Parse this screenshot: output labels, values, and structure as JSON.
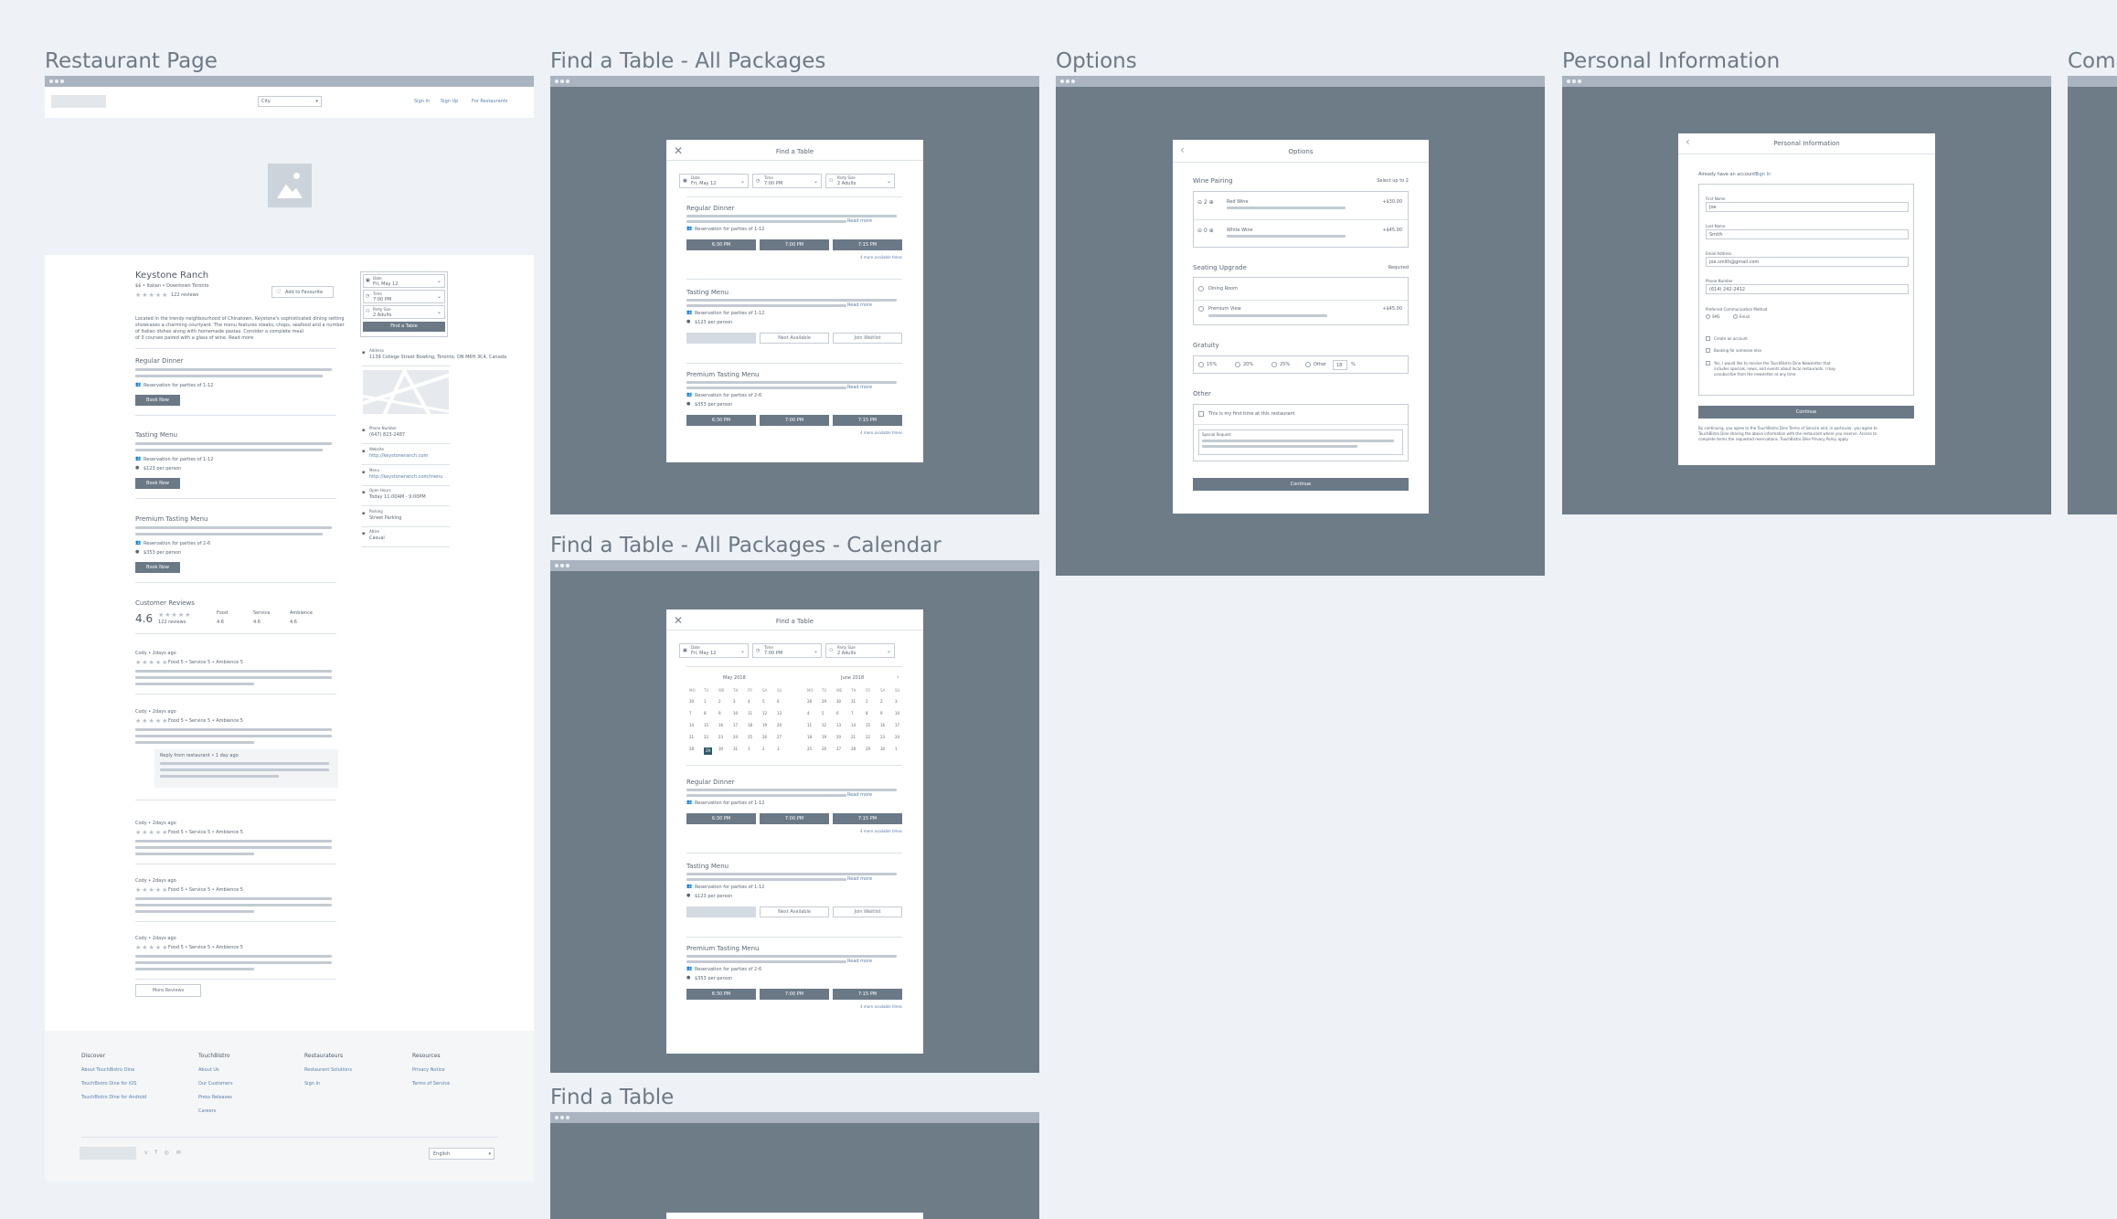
{
  "frames": {
    "restaurant": "Restaurant Page",
    "find_all": "Find a Table - All Packages",
    "options": "Options",
    "personal": "Personal Information",
    "comp": "Comp",
    "find_cal": "Find a Table - All Packages - Calendar",
    "find_table": "Find a Table"
  },
  "rp": {
    "city": "City",
    "signin": "Sign In",
    "signup": "Sign Up",
    "for_rest": "For Restaurants",
    "name": "Keystone Ranch",
    "meta": "$$ • Italian • Downtown Toronto",
    "reviews_count": "122 reviews",
    "fav": "Add to Favourite",
    "desc1": "Located in the trendy neighbourhood of Chinatown, Keystone's sophisticated dining setting",
    "desc2": "showcases a charming courtyard. The menu features steaks, chops, seafood and a number",
    "desc3": "of Italian dishes along with homemade pastas. Consider a complete meal",
    "desc4": "of 3 courses paired with a glass of wine. Read more",
    "pkgs": [
      {
        "name": "Regular Dinner",
        "res": "Reservation for parties of 1-12",
        "price": "",
        "book": "Book Now"
      },
      {
        "name": "Tasting Menu",
        "res": "Reservation for parties of 1-12",
        "price": "$123 per person",
        "book": "Book Now"
      },
      {
        "name": "Premium Tasting Menu",
        "res": "Reservation for parties of 2-6",
        "price": "$353 per person",
        "book": "Book Now"
      }
    ],
    "widget": {
      "date_l": "Date",
      "date": "Fri, May 12",
      "time_l": "Time",
      "time": "7:00 PM",
      "party_l": "Party Size",
      "party": "2 Adults",
      "btn": "Find a Table"
    },
    "side": [
      {
        "l": "Address",
        "v": "1139 College Street Bowling, Toronto, ON M6H 3C4, Canada"
      },
      {
        "l": "Phone Number",
        "v": "(647) 823-2487"
      },
      {
        "l": "Website",
        "v": "http://keystoneranch.com"
      },
      {
        "l": "Menu",
        "v": "http://keystoneranch.com/menu"
      },
      {
        "l": "Open Hours",
        "v": "Today 11:00AM - 9:00PM"
      },
      {
        "l": "Parking",
        "v": "Street Parking"
      },
      {
        "l": "Attire",
        "v": "Casual"
      }
    ],
    "cr": "Customer Reviews",
    "score": "4.6",
    "cr_count": "122 reviews",
    "sub": [
      {
        "l": "Food",
        "v": "4.6"
      },
      {
        "l": "Service",
        "v": "4.6"
      },
      {
        "l": "Ambience",
        "v": "4.6"
      }
    ],
    "review_head": "Cody • 2days ago",
    "review_sub": "Food 5 • Service 5 • Ambience 5",
    "reply": "Reply from restaurant • 1 day ago",
    "more": "More Reviews",
    "footer": [
      {
        "h": "Discover",
        "items": [
          "About TouchBistro Dine",
          "TouchBistro Dine for iOS",
          "TouchBistro Dine for Android"
        ]
      },
      {
        "h": "TouchBistro",
        "items": [
          "About Us",
          "Our Customers",
          "Press Releases",
          "Careers"
        ]
      },
      {
        "h": "Restaurateurs",
        "items": [
          "Restaurant Solutions",
          "Sign In"
        ]
      },
      {
        "h": "Resources",
        "items": [
          "Privacy Notice",
          "Terms of Service"
        ]
      }
    ],
    "lang": "English"
  },
  "fat": {
    "title": "Find a Table",
    "date_l": "Date",
    "date": "Fri, May 12",
    "time_l": "Time",
    "time": "7:00 PM",
    "party_l": "Party Size",
    "party": "2 Adults",
    "pkgs": [
      {
        "name": "Regular Dinner",
        "res": "Reservation for parties of 1-12",
        "price": "",
        "times": [
          "6:30 PM",
          "7:00 PM",
          "7:15 PM"
        ],
        "more": "4 more available times"
      },
      {
        "name": "Tasting Menu",
        "res": "Reservation for parties of 1-12",
        "price": "$123 per person",
        "next": "Next Available",
        "wait": "Join Waitlist"
      },
      {
        "name": "Premium Tasting Menu",
        "res": "Reservation for parties of 2-6",
        "price": "$353 per person",
        "times": [
          "6:30 PM",
          "7:00 PM",
          "7:15 PM"
        ],
        "more": "4 more available times"
      }
    ],
    "read_more": "Read more"
  },
  "cal": {
    "m1": "May 2018",
    "m2": "June 2018",
    "dows": [
      "MO",
      "TU",
      "WE",
      "TH",
      "FR",
      "SA",
      "SU"
    ],
    "may": [
      "30",
      "1",
      "2",
      "3",
      "4",
      "5",
      "6",
      "7",
      "8",
      "9",
      "10",
      "11",
      "12",
      "13",
      "14",
      "15",
      "16",
      "17",
      "18",
      "19",
      "20",
      "21",
      "22",
      "23",
      "24",
      "25",
      "26",
      "27",
      "28",
      "29",
      "30",
      "31",
      "1",
      "2",
      "3"
    ],
    "june": [
      "28",
      "29",
      "30",
      "31",
      "1",
      "2",
      "3",
      "4",
      "5",
      "6",
      "7",
      "8",
      "9",
      "10",
      "11",
      "12",
      "13",
      "14",
      "15",
      "16",
      "17",
      "18",
      "19",
      "20",
      "21",
      "22",
      "23",
      "24",
      "25",
      "26",
      "27",
      "28",
      "29",
      "30",
      "1"
    ]
  },
  "opt": {
    "title": "Options",
    "wine": "Wine Pairing",
    "select": "Select up to 2",
    "wines": [
      {
        "qty": "2",
        "name": "Red Wine",
        "price": "+$30.00"
      },
      {
        "qty": "0",
        "name": "White Wine",
        "price": "+$45.00"
      }
    ],
    "seating": "Seating Upgrade",
    "required": "Required",
    "seats": [
      {
        "name": "Dining Room",
        "price": ""
      },
      {
        "name": "Premium View",
        "price": "+$45.00"
      }
    ],
    "grat": "Gratuity",
    "pcts": [
      "15%",
      "20%",
      "25%",
      "Other"
    ],
    "other_val": "18",
    "pct": "%",
    "other": "Other",
    "first": "This is my first time at this restaurant",
    "special": "Special Request",
    "cont": "Continue"
  },
  "pi": {
    "title": "Personal Information",
    "already": "Already have an account?",
    "signin": "Sign In",
    "first_l": "First Name",
    "first": "Joe",
    "last_l": "Last Name",
    "last": "Smith",
    "email_l": "Email Address",
    "email": "joe.smith@gmail.com",
    "phone_l": "Phone Number",
    "phone": "(614) 242-2412",
    "pref": "Preferred Communication Method",
    "sms": "SMS",
    "emailm": "Email",
    "create": "Create an account",
    "booking": "Booking for someone else",
    "news1": "Yes, I would like to receive the TouchBistro Dine Newsletter that",
    "news2": "includes specials, news, and events about local restaurants. I may",
    "news3": "unsubscribe from the newsletter at any time.",
    "cont": "Continue",
    "legal1": "By continuing, you agree to the TouchBistro Dine Terms of Service and, in particular, you agree to",
    "legal2": "TouchBistro Dine sharing the above information with the restaurant where you reserve. Access to",
    "legal3": "complete terms the requested reservations. TouchBistro Dine Privacy Policy apply."
  },
  "colors": {
    "bg": "#eef1f5",
    "dark": "#6e7c88",
    "button": "#6b7886",
    "bar": "#aab4c0"
  }
}
